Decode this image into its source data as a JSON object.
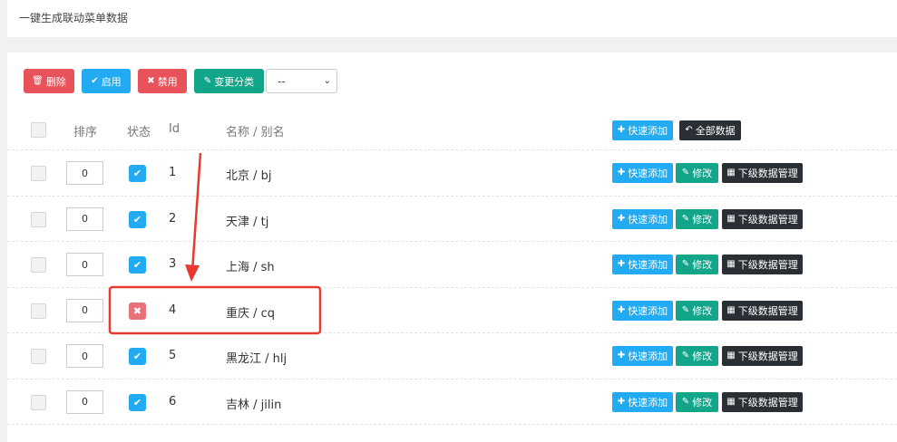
{
  "page": {
    "title": "一键生成联动菜单数据"
  },
  "toolbar": {
    "delete_label": "删除",
    "enable_label": "启用",
    "disable_label": "禁用",
    "change_category_label": "变更分类",
    "category_select_value": "--"
  },
  "table": {
    "headers": {
      "sort": "排序",
      "status": "状态",
      "id": "Id",
      "name": "名称 / 别名"
    },
    "header_actions": {
      "quick_add": "快速添加",
      "all_data": "全部数据"
    },
    "row_actions": {
      "quick_add": "快速添加",
      "edit": "修改",
      "sub_manage": "下级数据管理"
    },
    "rows": [
      {
        "sort": "0",
        "enabled": true,
        "id": "1",
        "name": "北京 / bj"
      },
      {
        "sort": "0",
        "enabled": true,
        "id": "2",
        "name": "天津 / tj"
      },
      {
        "sort": "0",
        "enabled": true,
        "id": "3",
        "name": "上海 / sh"
      },
      {
        "sort": "0",
        "enabled": false,
        "id": "4",
        "name": "重庆 / cq"
      },
      {
        "sort": "0",
        "enabled": true,
        "id": "5",
        "name": "黑龙江 / hlj"
      },
      {
        "sort": "0",
        "enabled": true,
        "id": "6",
        "name": "吉林 / jilin"
      }
    ]
  },
  "colors": {
    "accent_blue": "#22aaf2",
    "danger_red": "#e8525a",
    "teal": "#13a58a",
    "dark": "#2a2f36",
    "annotation_red": "#e8392f"
  },
  "icons": {
    "delete": "trash-icon",
    "enable": "check-circle-icon",
    "disable": "x-circle-icon",
    "change": "edit-icon",
    "quick_add": "plus-icon",
    "all_data": "undo-arrow-icon",
    "edit": "edit-icon",
    "sub_manage": "table-icon",
    "checked": "check-icon",
    "unchecked": "x-icon"
  }
}
